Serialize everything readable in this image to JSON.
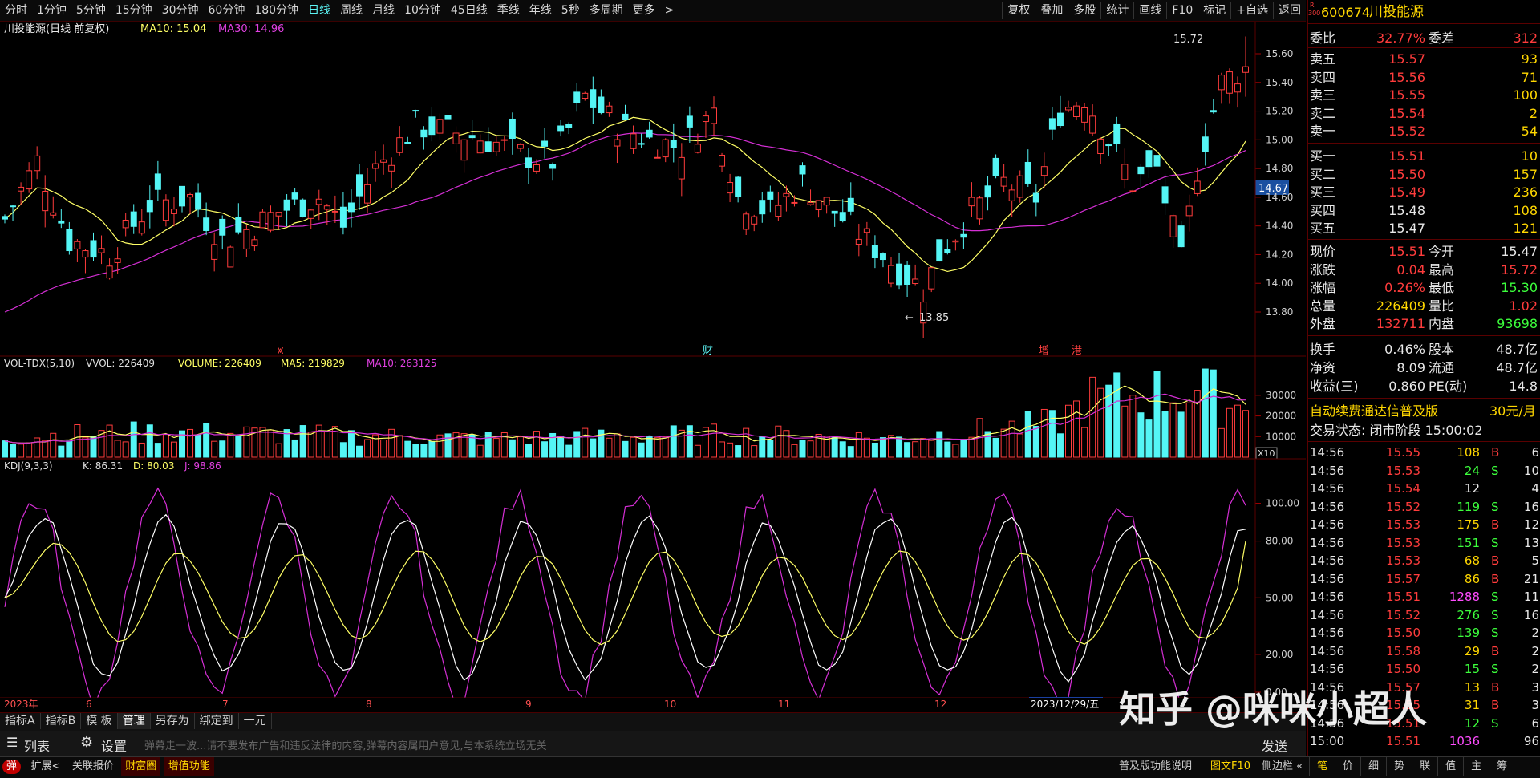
{
  "toolbar": {
    "periods": [
      "分时",
      "1分钟",
      "5分钟",
      "15分钟",
      "30分钟",
      "60分钟",
      "180分钟",
      "日线",
      "周线",
      "月线",
      "10分钟",
      "45日线",
      "季线",
      "年线",
      "5秒",
      "多周期",
      "更多"
    ],
    "active_period": "日线",
    "more_chevron": ">",
    "right_items": [
      "复权",
      "叠加",
      "多股",
      "统计",
      "画线",
      "F10",
      "标记",
      "+自选",
      "返回"
    ]
  },
  "main_chart": {
    "title": "川投能源(日线 前复权)",
    "ma10_label": "MA10: 15.04",
    "ma30_label": "MA30: 14.96",
    "high_label": "15.72",
    "low_label": "13.85",
    "price_tag": "14.67",
    "y_ticks": [
      "15.60",
      "15.40",
      "15.20",
      "15.00",
      "14.80",
      "14.60",
      "14.40",
      "14.20",
      "14.00",
      "13.80"
    ],
    "event_markers": [
      "⩙",
      "财",
      "增",
      "港"
    ]
  },
  "vol_chart": {
    "title": "VOL-TDX(5,10)",
    "vvol": "VVOL: 226409",
    "volume": "VOLUME: 226409",
    "ma5": "MA5: 219829",
    "ma10": "MA10: 263125",
    "y_ticks": [
      "30000",
      "20000",
      "10000"
    ],
    "unit": "X10"
  },
  "kdj_chart": {
    "title": "KDJ(9,3,3)",
    "k": "K: 86.31",
    "d": "D: 80.03",
    "j": "J: 98.86",
    "y_ticks": [
      "100.00",
      "80.00",
      "50.00",
      "20.00",
      "0.00"
    ]
  },
  "x_axis": {
    "labels": [
      "2023年",
      "6",
      "7",
      "8",
      "9",
      "10",
      "11",
      "12"
    ],
    "cursor_date": "2023/12/29/五"
  },
  "bottom_tabs": [
    "指标A",
    "指标B",
    "模 板",
    "管理",
    "另存为",
    "绑定到",
    "一元"
  ],
  "danmu": {
    "list_label": "列表",
    "settings_label": "设置",
    "placeholder": "弹幕走一波...请不要发布广告和违反法律的内容,弹幕内容属用户意见,与本系统立场无关",
    "send_label": "发送"
  },
  "status_bar": {
    "left": [
      "弹",
      "扩展<",
      "关联报价",
      "财富圈",
      "增值功能"
    ],
    "right": [
      "普及版功能说明",
      "图文F10",
      "侧边栏 «"
    ],
    "right_tabs": [
      "笔",
      "价",
      "细",
      "势",
      "联",
      "值",
      "主",
      "筹"
    ]
  },
  "quote": {
    "code": "600674",
    "name": "川投能源",
    "badge_top": "R",
    "badge_bottom": "300",
    "weibi_label": "委比",
    "weibi_value": "32.77%",
    "weicha_label": "委差",
    "weicha_value": "312",
    "asks": [
      {
        "label": "卖五",
        "price": "15.57",
        "vol": "93"
      },
      {
        "label": "卖四",
        "price": "15.56",
        "vol": "71"
      },
      {
        "label": "卖三",
        "price": "15.55",
        "vol": "100"
      },
      {
        "label": "卖二",
        "price": "15.54",
        "vol": "2"
      },
      {
        "label": "卖一",
        "price": "15.52",
        "vol": "54"
      }
    ],
    "bids": [
      {
        "label": "买一",
        "price": "15.51",
        "vol": "10"
      },
      {
        "label": "买二",
        "price": "15.50",
        "vol": "157"
      },
      {
        "label": "买三",
        "price": "15.49",
        "vol": "236"
      },
      {
        "label": "买四",
        "price": "15.48",
        "vol": "108"
      },
      {
        "label": "买五",
        "price": "15.47",
        "vol": "121"
      }
    ],
    "stats": [
      {
        "l1": "现价",
        "v1": "15.51",
        "c1": "red",
        "l2": "今开",
        "v2": "15.47",
        "c2": "white"
      },
      {
        "l1": "涨跌",
        "v1": "0.04",
        "c1": "red",
        "l2": "最高",
        "v2": "15.72",
        "c2": "red"
      },
      {
        "l1": "涨幅",
        "v1": "0.26%",
        "c1": "red",
        "l2": "最低",
        "v2": "15.30",
        "c2": "green"
      },
      {
        "l1": "总量",
        "v1": "226409",
        "c1": "yellow",
        "l2": "量比",
        "v2": "1.02",
        "c2": "red"
      },
      {
        "l1": "外盘",
        "v1": "132711",
        "c1": "red",
        "l2": "内盘",
        "v2": "93698",
        "c2": "green"
      }
    ],
    "stats2": [
      {
        "l1": "换手",
        "v1": "0.46%",
        "l2": "股本",
        "v2": "48.7亿"
      },
      {
        "l1": "净资",
        "v1": "8.09",
        "l2": "流通",
        "v2": "48.7亿"
      },
      {
        "l1": "收益(三)",
        "v1": "0.860",
        "l2": "PE(动)",
        "v2": "14.8"
      }
    ],
    "ad_text": "自动续费通达信普及版",
    "ad_price": "30元/月",
    "trade_status": "交易状态: 闭市阶段 15:00:02"
  },
  "ticks": [
    {
      "t": "14:56",
      "p": "15.55",
      "v": "108",
      "bs": "B",
      "n": "6"
    },
    {
      "t": "14:56",
      "p": "15.53",
      "v": "24",
      "bs": "S",
      "n": "10"
    },
    {
      "t": "14:56",
      "p": "15.54",
      "v": "12",
      "bs": "",
      "n": "4"
    },
    {
      "t": "14:56",
      "p": "15.52",
      "v": "119",
      "bs": "S",
      "n": "16"
    },
    {
      "t": "14:56",
      "p": "15.53",
      "v": "175",
      "bs": "B",
      "n": "12"
    },
    {
      "t": "14:56",
      "p": "15.53",
      "v": "151",
      "bs": "S",
      "n": "13"
    },
    {
      "t": "14:56",
      "p": "15.53",
      "v": "68",
      "bs": "B",
      "n": "5"
    },
    {
      "t": "14:56",
      "p": "15.57",
      "v": "86",
      "bs": "B",
      "n": "21"
    },
    {
      "t": "14:56",
      "p": "15.51",
      "v": "1288",
      "bs": "S",
      "n": "11"
    },
    {
      "t": "14:56",
      "p": "15.52",
      "v": "276",
      "bs": "S",
      "n": "16"
    },
    {
      "t": "14:56",
      "p": "15.50",
      "v": "139",
      "bs": "S",
      "n": "2"
    },
    {
      "t": "14:56",
      "p": "15.58",
      "v": "29",
      "bs": "B",
      "n": "2"
    },
    {
      "t": "14:56",
      "p": "15.50",
      "v": "15",
      "bs": "S",
      "n": "2"
    },
    {
      "t": "14:56",
      "p": "15.57",
      "v": "13",
      "bs": "B",
      "n": "3"
    },
    {
      "t": "14:56",
      "p": "15.55",
      "v": "31",
      "bs": "B",
      "n": "3"
    },
    {
      "t": "14:56",
      "p": "15.51",
      "v": "12",
      "bs": "S",
      "n": "6"
    },
    {
      "t": "15:00",
      "p": "15.51",
      "v": "1036",
      "bs": "",
      "n": "96"
    }
  ],
  "watermark": "知乎 @咪咪小超人",
  "colors": {
    "up": "#ff3c3c",
    "down": "#54f5f5",
    "ma10": "#ffff66",
    "ma30": "#d52fd5",
    "k": "#ffffff",
    "d": "#ffff66",
    "j": "#d52fd5"
  }
}
